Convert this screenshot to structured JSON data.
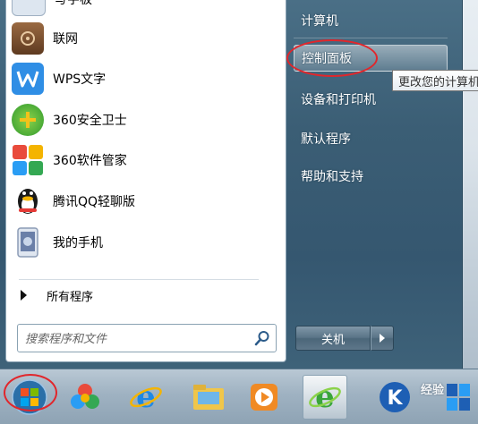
{
  "left_pane": {
    "partial_top_label": "写字板",
    "programs": [
      {
        "label": "联网",
        "icon": "network-box-icon",
        "color": "#7a4a2a"
      },
      {
        "label": "WPS文字",
        "icon": "wps-writer-icon",
        "color": "#2f8ee5"
      },
      {
        "label": "360安全卫士",
        "icon": "360-safeguard-icon",
        "color": "#3aa53a"
      },
      {
        "label": "360软件管家",
        "icon": "360-software-manager-icon",
        "color": "#e64545"
      },
      {
        "label": "腾讯QQ轻聊版",
        "icon": "qq-penguin-icon",
        "color": "#222222"
      },
      {
        "label": "我的手机",
        "icon": "phone-icon",
        "color": "#6a7fa8"
      }
    ],
    "all_programs": "所有程序",
    "search_placeholder": "搜索程序和文件"
  },
  "right_pane": {
    "items": [
      {
        "label": "计算机"
      },
      {
        "label": "控制面板"
      },
      {
        "label": "设备和打印机"
      },
      {
        "label": "默认程序"
      },
      {
        "label": "帮助和支持"
      }
    ],
    "tooltip": "更改您的计算机",
    "shutdown_label": "关机"
  },
  "taskbar": {
    "items": [
      {
        "icon": "windows-orb-icon"
      },
      {
        "icon": "360-browser-icon"
      },
      {
        "icon": "internet-explorer-icon"
      },
      {
        "icon": "file-explorer-icon"
      },
      {
        "icon": "media-player-icon"
      },
      {
        "icon": "green-browser-icon"
      },
      {
        "icon": "baidu-k-icon"
      },
      {
        "icon": "tiles-icon"
      }
    ],
    "watermark": "经验"
  },
  "colors": {
    "annotation_red": "#e1262b",
    "menu_blue": "#3b5e75"
  }
}
